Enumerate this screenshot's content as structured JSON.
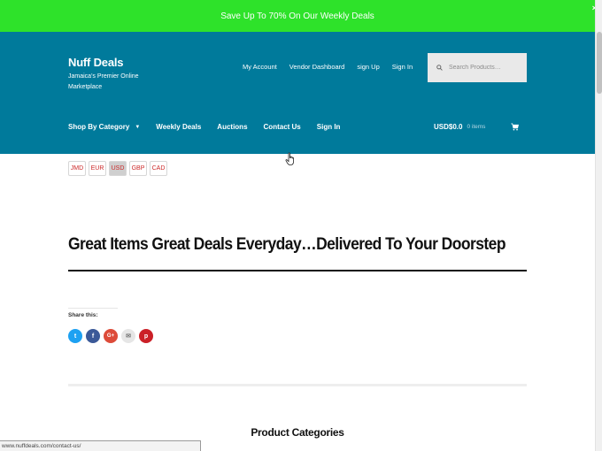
{
  "promo": {
    "text": "Save Up To 70% On Our Weekly Deals",
    "close": "×"
  },
  "brand": {
    "title": "Nuff Deals",
    "tagline": "Jamaica's Premier Online Marketplace"
  },
  "top_links": [
    {
      "label": "My Account"
    },
    {
      "label": "Vendor Dashboard"
    },
    {
      "label": "sign Up"
    },
    {
      "label": "Sign In"
    }
  ],
  "search": {
    "placeholder": "Search Products…",
    "icon": "search-icon"
  },
  "nav": {
    "shop_by_category": "Shop By Category",
    "weekly_deals": "Weekly Deals",
    "auctions": "Auctions",
    "contact_us": "Contact Us",
    "sign_in": "Sign In"
  },
  "cart": {
    "total": "USD$0.0",
    "items": "0 items",
    "icon": "cart-icon"
  },
  "currencies": [
    {
      "code": "JMD"
    },
    {
      "code": "EUR"
    },
    {
      "code": "USD",
      "active": true
    },
    {
      "code": "GBP"
    },
    {
      "code": "CAD"
    }
  ],
  "page": {
    "title": "Great Items Great Deals Everyday…Delivered To Your Doorstep",
    "share_label": "Share this:",
    "section_heading": "Product Categories"
  },
  "share_buttons": [
    {
      "name": "twitter",
      "glyph": "t",
      "color": "#1da1f2"
    },
    {
      "name": "facebook",
      "glyph": "f",
      "color": "#3b5998"
    },
    {
      "name": "google-plus",
      "glyph": "G+",
      "color": "#dd4b39"
    },
    {
      "name": "email",
      "glyph": "✉",
      "color": "#e6e6e6"
    },
    {
      "name": "pinterest",
      "glyph": "p",
      "color": "#cb2027"
    }
  ],
  "status": {
    "url": "www.nuffdeals.com/contact-us/"
  },
  "colors": {
    "promo_bg": "#2ee22a",
    "header_bg": "#007a9b",
    "accent_red": "#cc2a2a"
  }
}
